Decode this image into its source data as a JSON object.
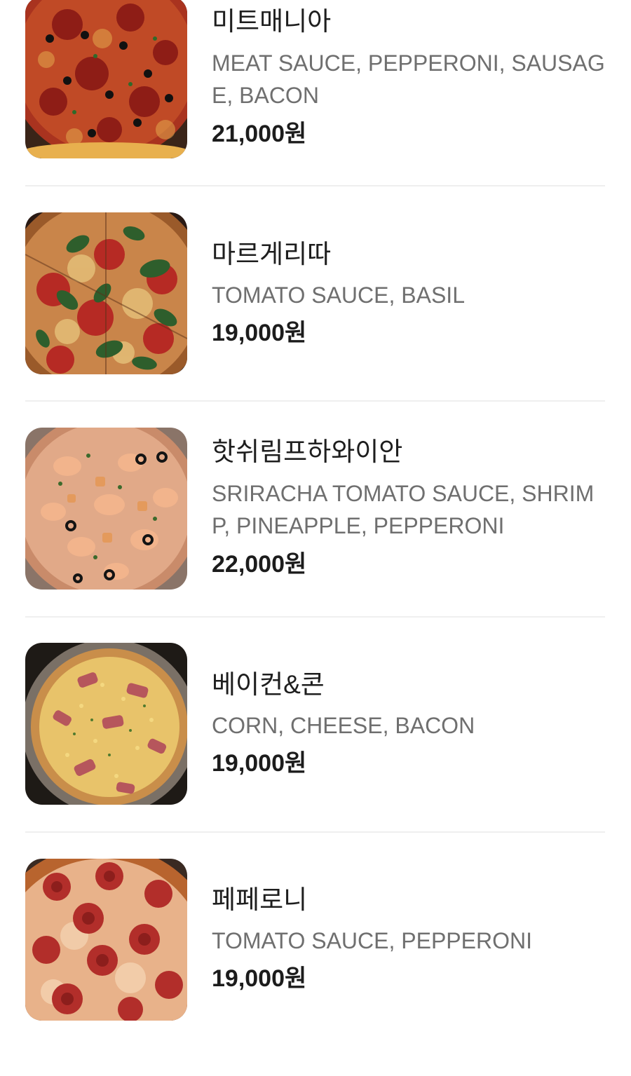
{
  "menu": {
    "items": [
      {
        "name": "미트매니아",
        "description": "MEAT SAUCE, PEPPERONI, SAUSAGE, BACON",
        "price": "21,000원",
        "image": "pizza-meat-mania-photo"
      },
      {
        "name": "마르게리따",
        "description": "TOMATO SAUCE, BASIL",
        "price": "19,000원",
        "image": "pizza-margherita-photo"
      },
      {
        "name": "핫쉬림프하와이안",
        "description": "SRIRACHA TOMATO SAUCE, SHRIMP, PINEAPPLE, PEPPERONI",
        "price": "22,000원",
        "image": "pizza-hot-shrimp-hawaiian-photo"
      },
      {
        "name": "베이컨&콘",
        "description": "CORN, CHEESE, BACON",
        "price": "19,000원",
        "image": "pizza-bacon-corn-photo"
      },
      {
        "name": "페페로니",
        "description": "TOMATO SAUCE, PEPPERONI",
        "price": "19,000원",
        "image": "pizza-pepperoni-photo"
      }
    ]
  },
  "colors": {
    "background": "#ffffff",
    "name_text": "#1e1e1e",
    "description_text": "#6f6f6f",
    "price_text": "#1c1c1c",
    "divider": "#efefef"
  }
}
